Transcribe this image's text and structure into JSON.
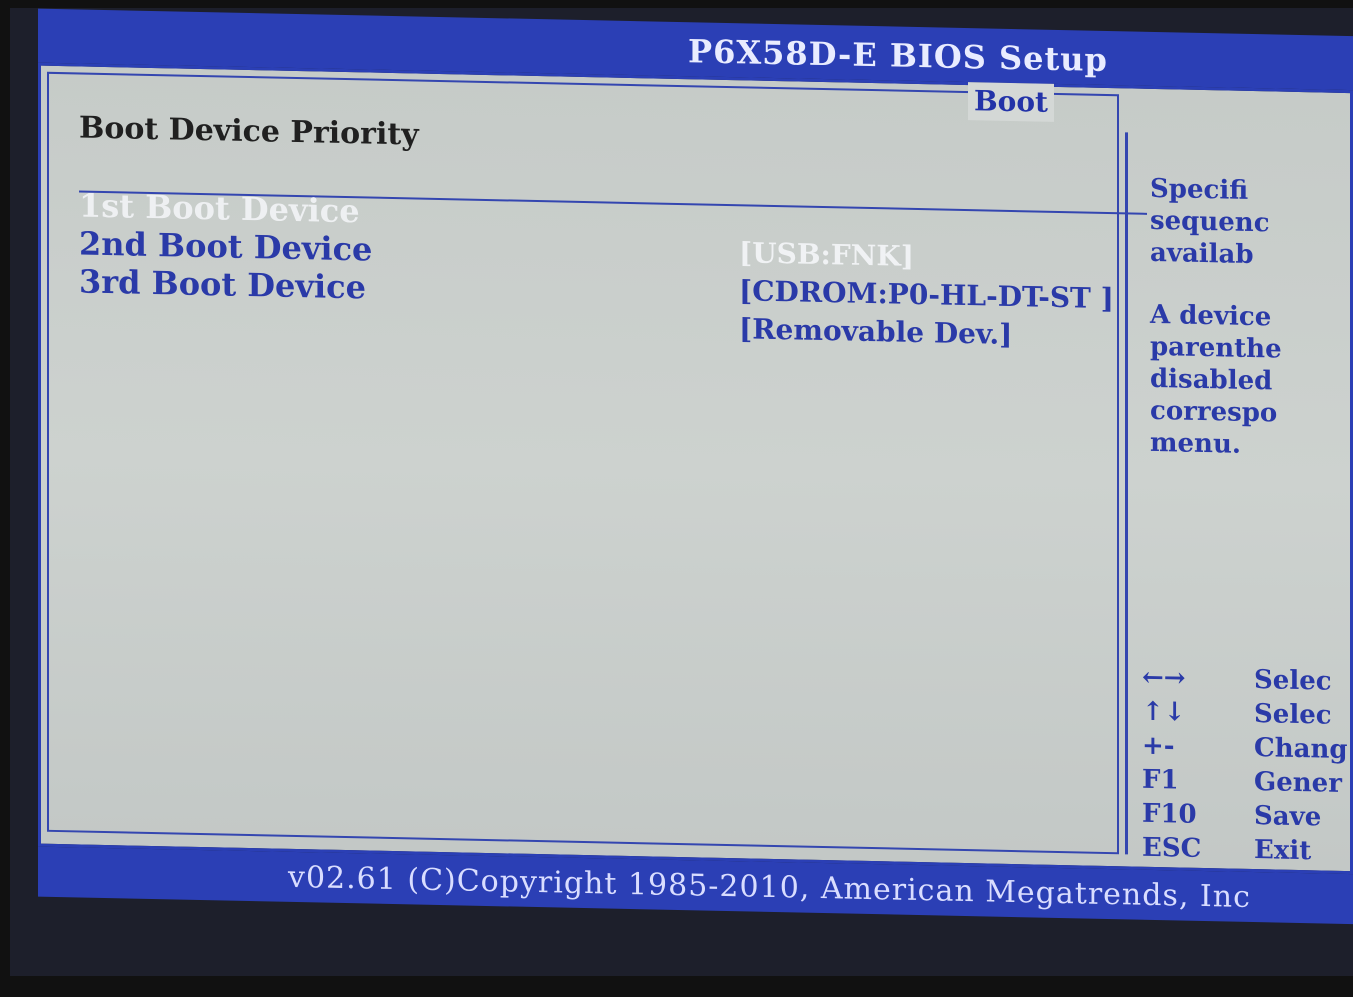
{
  "header": {
    "title": "P6X58D-E BIOS Setup",
    "active_tab": "Boot"
  },
  "section": {
    "title": "Boot Device Priority"
  },
  "boot_items": [
    {
      "label": "1st Boot Device",
      "value": "[USB:FNK]"
    },
    {
      "label": "2nd Boot Device",
      "value": "[CDROM:P0-HL-DT-ST ]"
    },
    {
      "label": "3rd Boot Device",
      "value": "[Removable Dev.]"
    }
  ],
  "help": {
    "lines1": [
      "Specifi",
      "sequenc",
      "availab"
    ],
    "lines2": [
      "A device",
      "parenthe",
      "disabled",
      "correspo",
      "menu."
    ]
  },
  "keys": [
    {
      "key": "←→",
      "action": "Selec"
    },
    {
      "key": "↑↓",
      "action": "Selec"
    },
    {
      "key": "+-",
      "action": "Chang"
    },
    {
      "key": "F1",
      "action": "Gener"
    },
    {
      "key": "F10",
      "action": "Save"
    },
    {
      "key": "ESC",
      "action": "Exit"
    }
  ],
  "footer": {
    "text": "v02.61 (C)Copyright 1985-2010, American Megatrends, Inc"
  },
  "colors": {
    "blue": "#2b3fb5",
    "panel": "#cdd2cf",
    "text_blue": "#2a3aa8",
    "selected": "#eef0f2"
  }
}
